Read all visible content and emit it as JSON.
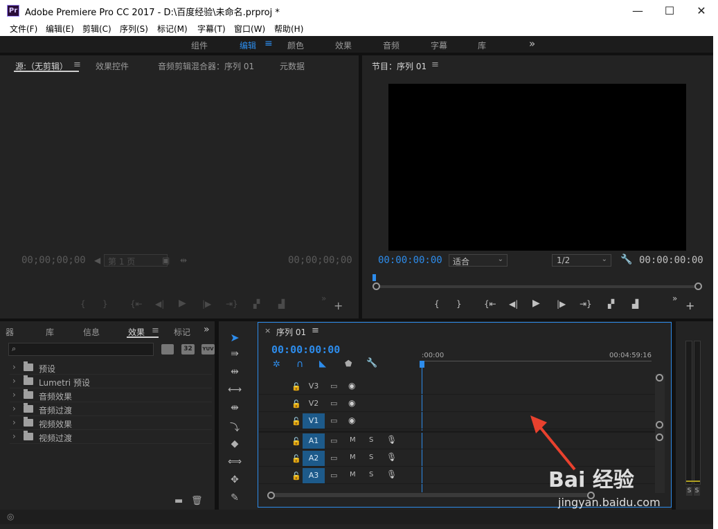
{
  "window": {
    "app_abbrev": "Pr",
    "title": "Adobe Premiere Pro CC 2017 - D:\\百度经验\\未命名.prproj *",
    "minimize": "—",
    "maximize": "☐",
    "close": "✕"
  },
  "menu": [
    "文件(F)",
    "编辑(E)",
    "剪辑(C)",
    "序列(S)",
    "标记(M)",
    "字幕(T)",
    "窗口(W)",
    "帮助(H)"
  ],
  "workspaces": {
    "items": [
      "组件",
      "编辑",
      "颜色",
      "效果",
      "音频",
      "字幕",
      "库"
    ],
    "active": "编辑",
    "overflow": "»"
  },
  "source_panel": {
    "tabs": [
      "源:（无剪辑）",
      "效果控件",
      "音频剪辑混合器：序列 01",
      "元数据"
    ],
    "menu_icon": "≡",
    "timecode_left": "00;00;00;00",
    "timecode_right": "00;00;00;00",
    "page_label": "第 1 页"
  },
  "program_panel": {
    "title": "节目：序列 01",
    "menu_icon": "≡",
    "timecode_left": "00:00:00:00",
    "fit_select": "适合",
    "resolution_select": "1/2",
    "timecode_right": "00:00:00:00"
  },
  "effects_panel": {
    "tabs": [
      "器",
      "库",
      "信息",
      "效果",
      "标记"
    ],
    "active_tab": "效果",
    "menu_icon": "≡",
    "overflow": "»",
    "search_placeholder": "",
    "badges": [
      "32",
      "YUV"
    ],
    "items": [
      "预设",
      "Lumetri 预设",
      "音频效果",
      "音频过渡",
      "视频效果",
      "视频过渡"
    ]
  },
  "timeline": {
    "close": "×",
    "tab": "序列 01",
    "menu_icon": "≡",
    "timecode": "00:00:00:00",
    "ruler_start": ":00:00",
    "ruler_end": "00:04:59:16",
    "video_tracks": [
      "V3",
      "V2",
      "V1"
    ],
    "audio_tracks": [
      "A1",
      "A2",
      "A3"
    ],
    "mute_label": "M",
    "solo_label": "S"
  },
  "meters": {
    "solo_labels": [
      "S",
      "S"
    ]
  },
  "watermark": {
    "site": "jingyan.baidu.com",
    "brand": "Bai 经验"
  },
  "colors": {
    "accent_blue": "#2d8ceb",
    "track_on": "#1d5a8a",
    "panel_bg": "#232323"
  }
}
